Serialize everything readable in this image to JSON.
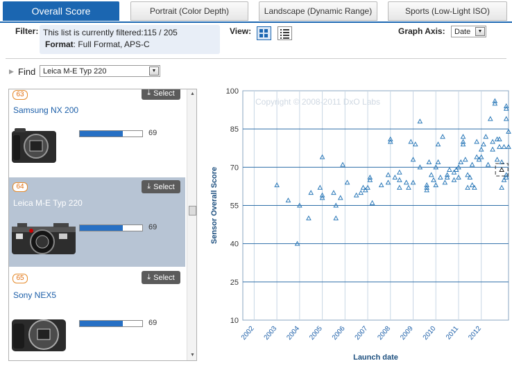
{
  "tabs": {
    "overall": "Overall Score",
    "portrait": "Portrait (Color Depth)",
    "landscape": "Landscape (Dynamic Range)",
    "sports": "Sports (Low-Light ISO)"
  },
  "filter": {
    "label": "Filter:",
    "line1": "This list is currently filtered:115 / 205",
    "format_label": "Format",
    "format_value": ": Full Format, APS-C"
  },
  "view": {
    "label": "View:",
    "grid_icon": "grid-view-icon",
    "list_icon": "list-view-icon"
  },
  "graph_axis": {
    "label": "Graph Axis:",
    "value": "Date"
  },
  "find": {
    "label": "Find",
    "value": "Leica M-E Typ 220"
  },
  "cameras": [
    {
      "rank": "63",
      "name": "Samsung NX 200",
      "score": "69",
      "score_fraction": 0.69,
      "select": "Select",
      "selected": false
    },
    {
      "rank": "64",
      "name": "Leica M-E Typ 220",
      "score": "69",
      "score_fraction": 0.69,
      "select": "Select",
      "selected": true
    },
    {
      "rank": "65",
      "name": "Sony NEX5",
      "score": "69",
      "score_fraction": 0.69,
      "select": "Select",
      "selected": false
    }
  ],
  "chart_data": {
    "type": "scatter",
    "watermark": "Copyright © 2008-2011 DxO Labs",
    "xlabel": "Launch date",
    "ylabel": "Sensor Overall Score",
    "xlim": [
      2001.5,
      2013.2
    ],
    "ylim": [
      10,
      100
    ],
    "xticks": [
      "2002",
      "2003",
      "2004",
      "2005",
      "2006",
      "2007",
      "2008",
      "2009",
      "2010",
      "2011",
      "2012"
    ],
    "yticks": [
      10,
      25,
      40,
      55,
      70,
      85,
      100
    ],
    "grid": true,
    "marker": "triangle",
    "highlight": {
      "x": 2012.9,
      "y": 69
    },
    "points": [
      [
        2003.0,
        63
      ],
      [
        2003.5,
        57
      ],
      [
        2003.9,
        40
      ],
      [
        2004.0,
        55
      ],
      [
        2004.4,
        50
      ],
      [
        2004.5,
        60
      ],
      [
        2004.9,
        62
      ],
      [
        2005.0,
        59
      ],
      [
        2005.0,
        58
      ],
      [
        2005.0,
        74
      ],
      [
        2005.5,
        60
      ],
      [
        2005.6,
        50
      ],
      [
        2005.6,
        55
      ],
      [
        2005.8,
        58
      ],
      [
        2005.9,
        71
      ],
      [
        2006.1,
        64
      ],
      [
        2006.5,
        59
      ],
      [
        2006.7,
        60
      ],
      [
        2006.8,
        62
      ],
      [
        2006.9,
        61
      ],
      [
        2007.0,
        62
      ],
      [
        2007.1,
        65
      ],
      [
        2007.1,
        66
      ],
      [
        2007.2,
        56
      ],
      [
        2007.6,
        63
      ],
      [
        2007.9,
        64
      ],
      [
        2007.9,
        67
      ],
      [
        2008.0,
        80
      ],
      [
        2008.0,
        81
      ],
      [
        2008.2,
        66
      ],
      [
        2008.4,
        62
      ],
      [
        2008.4,
        65
      ],
      [
        2008.4,
        68
      ],
      [
        2008.7,
        64
      ],
      [
        2008.8,
        62
      ],
      [
        2008.9,
        80
      ],
      [
        2009.0,
        64
      ],
      [
        2009.0,
        73
      ],
      [
        2009.1,
        79
      ],
      [
        2009.3,
        88
      ],
      [
        2009.3,
        70
      ],
      [
        2009.6,
        62
      ],
      [
        2009.6,
        61
      ],
      [
        2009.6,
        63
      ],
      [
        2009.7,
        72
      ],
      [
        2009.8,
        67
      ],
      [
        2009.9,
        65
      ],
      [
        2010.0,
        63
      ],
      [
        2010.0,
        70
      ],
      [
        2010.1,
        79
      ],
      [
        2010.1,
        72
      ],
      [
        2010.2,
        66
      ],
      [
        2010.3,
        82
      ],
      [
        2010.4,
        64
      ],
      [
        2010.5,
        66
      ],
      [
        2010.5,
        67
      ],
      [
        2010.6,
        69
      ],
      [
        2010.8,
        65
      ],
      [
        2010.8,
        68
      ],
      [
        2010.9,
        69
      ],
      [
        2011.0,
        66
      ],
      [
        2011.0,
        70
      ],
      [
        2011.1,
        72
      ],
      [
        2011.2,
        79
      ],
      [
        2011.2,
        80
      ],
      [
        2011.2,
        82
      ],
      [
        2011.3,
        73
      ],
      [
        2011.4,
        62
      ],
      [
        2011.4,
        67
      ],
      [
        2011.5,
        66
      ],
      [
        2011.6,
        63
      ],
      [
        2011.6,
        71
      ],
      [
        2011.7,
        62
      ],
      [
        2011.8,
        80
      ],
      [
        2011.8,
        74
      ],
      [
        2011.9,
        73
      ],
      [
        2012.0,
        74
      ],
      [
        2012.0,
        77
      ],
      [
        2012.1,
        79
      ],
      [
        2012.2,
        82
      ],
      [
        2012.3,
        71
      ],
      [
        2012.4,
        89
      ],
      [
        2012.5,
        77
      ],
      [
        2012.5,
        80
      ],
      [
        2012.6,
        95
      ],
      [
        2012.6,
        96
      ],
      [
        2012.7,
        81
      ],
      [
        2012.7,
        73
      ],
      [
        2012.8,
        78
      ],
      [
        2012.8,
        81
      ],
      [
        2012.9,
        72
      ],
      [
        2012.9,
        62
      ],
      [
        2013.0,
        65
      ],
      [
        2013.0,
        78
      ],
      [
        2013.1,
        93
      ],
      [
        2013.1,
        94
      ],
      [
        2013.1,
        89
      ],
      [
        2013.1,
        67
      ],
      [
        2013.1,
        66
      ],
      [
        2013.2,
        84
      ],
      [
        2013.2,
        78
      ]
    ]
  }
}
